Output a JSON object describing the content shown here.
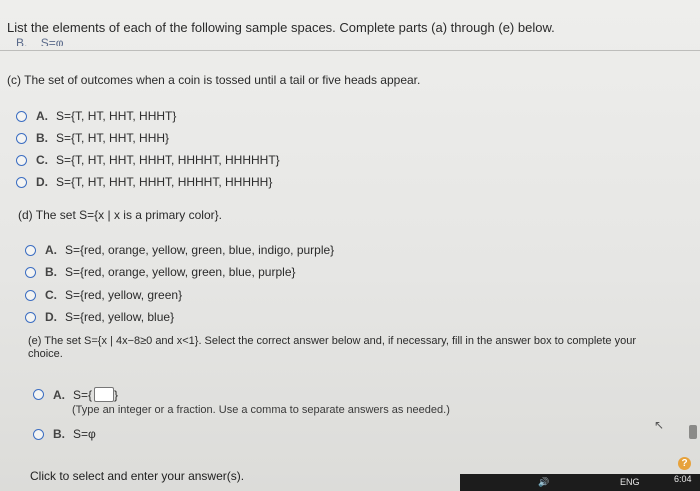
{
  "header": {
    "instruction": "List the elements of each of the following sample spaces. Complete parts (a) through (e) below."
  },
  "partB_cut": {
    "label": "B.",
    "value": "S=φ"
  },
  "partC": {
    "question": "(c) The set of outcomes when a coin is tossed until a tail or five heads appear.",
    "options": [
      {
        "letter": "A.",
        "text": "S={T, HT, HHT, HHHT}"
      },
      {
        "letter": "B.",
        "text": "S={T, HT, HHT, HHH}"
      },
      {
        "letter": "C.",
        "text": "S={T, HT, HHT, HHHT, HHHHT, HHHHHT}"
      },
      {
        "letter": "D.",
        "text": "S={T, HT, HHT, HHHT, HHHHT, HHHHH}"
      }
    ]
  },
  "partD": {
    "question": "(d) The set S={x | x is a primary color}.",
    "options": [
      {
        "letter": "A.",
        "text": "S={red, orange, yellow, green, blue, indigo, purple}"
      },
      {
        "letter": "B.",
        "text": "S={red, orange, yellow, green, blue, purple}"
      },
      {
        "letter": "C.",
        "text": "S={red, yellow, green}"
      },
      {
        "letter": "D.",
        "text": "S={red, yellow, blue}"
      }
    ]
  },
  "partE": {
    "question_line1": "(e) The set S={x | 4x−8≥0 and x<1}. Select the correct answer below and, if necessary, fill in the answer box to complete your",
    "question_line2": "choice.",
    "optionA": {
      "letter": "A.",
      "prefix": "S={",
      "suffix": "}"
    },
    "hint": "(Type an integer or a fraction. Use a comma to separate answers as needed.)",
    "optionB": {
      "letter": "B.",
      "text": "S=φ"
    }
  },
  "footer": {
    "click_text": "Click to select and enter your answer(s)."
  },
  "taskbar": {
    "lang": "ENG",
    "time": "6:04"
  },
  "help_icon": {
    "label": "?"
  }
}
